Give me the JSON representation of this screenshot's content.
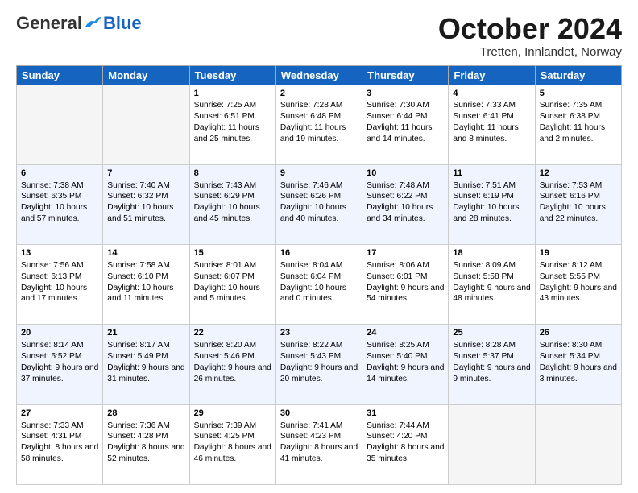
{
  "header": {
    "logo_general": "General",
    "logo_blue": "Blue",
    "title": "October 2024",
    "location": "Tretten, Innlandet, Norway"
  },
  "weekdays": [
    "Sunday",
    "Monday",
    "Tuesday",
    "Wednesday",
    "Thursday",
    "Friday",
    "Saturday"
  ],
  "weeks": [
    [
      {
        "day": "",
        "sunrise": "",
        "sunset": "",
        "daylight": "",
        "empty": true
      },
      {
        "day": "",
        "sunrise": "",
        "sunset": "",
        "daylight": "",
        "empty": true
      },
      {
        "day": "1",
        "sunrise": "Sunrise: 7:25 AM",
        "sunset": "Sunset: 6:51 PM",
        "daylight": "Daylight: 11 hours and 25 minutes."
      },
      {
        "day": "2",
        "sunrise": "Sunrise: 7:28 AM",
        "sunset": "Sunset: 6:48 PM",
        "daylight": "Daylight: 11 hours and 19 minutes."
      },
      {
        "day": "3",
        "sunrise": "Sunrise: 7:30 AM",
        "sunset": "Sunset: 6:44 PM",
        "daylight": "Daylight: 11 hours and 14 minutes."
      },
      {
        "day": "4",
        "sunrise": "Sunrise: 7:33 AM",
        "sunset": "Sunset: 6:41 PM",
        "daylight": "Daylight: 11 hours and 8 minutes."
      },
      {
        "day": "5",
        "sunrise": "Sunrise: 7:35 AM",
        "sunset": "Sunset: 6:38 PM",
        "daylight": "Daylight: 11 hours and 2 minutes."
      }
    ],
    [
      {
        "day": "6",
        "sunrise": "Sunrise: 7:38 AM",
        "sunset": "Sunset: 6:35 PM",
        "daylight": "Daylight: 10 hours and 57 minutes."
      },
      {
        "day": "7",
        "sunrise": "Sunrise: 7:40 AM",
        "sunset": "Sunset: 6:32 PM",
        "daylight": "Daylight: 10 hours and 51 minutes."
      },
      {
        "day": "8",
        "sunrise": "Sunrise: 7:43 AM",
        "sunset": "Sunset: 6:29 PM",
        "daylight": "Daylight: 10 hours and 45 minutes."
      },
      {
        "day": "9",
        "sunrise": "Sunrise: 7:46 AM",
        "sunset": "Sunset: 6:26 PM",
        "daylight": "Daylight: 10 hours and 40 minutes."
      },
      {
        "day": "10",
        "sunrise": "Sunrise: 7:48 AM",
        "sunset": "Sunset: 6:22 PM",
        "daylight": "Daylight: 10 hours and 34 minutes."
      },
      {
        "day": "11",
        "sunrise": "Sunrise: 7:51 AM",
        "sunset": "Sunset: 6:19 PM",
        "daylight": "Daylight: 10 hours and 28 minutes."
      },
      {
        "day": "12",
        "sunrise": "Sunrise: 7:53 AM",
        "sunset": "Sunset: 6:16 PM",
        "daylight": "Daylight: 10 hours and 22 minutes."
      }
    ],
    [
      {
        "day": "13",
        "sunrise": "Sunrise: 7:56 AM",
        "sunset": "Sunset: 6:13 PM",
        "daylight": "Daylight: 10 hours and 17 minutes."
      },
      {
        "day": "14",
        "sunrise": "Sunrise: 7:58 AM",
        "sunset": "Sunset: 6:10 PM",
        "daylight": "Daylight: 10 hours and 11 minutes."
      },
      {
        "day": "15",
        "sunrise": "Sunrise: 8:01 AM",
        "sunset": "Sunset: 6:07 PM",
        "daylight": "Daylight: 10 hours and 5 minutes."
      },
      {
        "day": "16",
        "sunrise": "Sunrise: 8:04 AM",
        "sunset": "Sunset: 6:04 PM",
        "daylight": "Daylight: 10 hours and 0 minutes."
      },
      {
        "day": "17",
        "sunrise": "Sunrise: 8:06 AM",
        "sunset": "Sunset: 6:01 PM",
        "daylight": "Daylight: 9 hours and 54 minutes."
      },
      {
        "day": "18",
        "sunrise": "Sunrise: 8:09 AM",
        "sunset": "Sunset: 5:58 PM",
        "daylight": "Daylight: 9 hours and 48 minutes."
      },
      {
        "day": "19",
        "sunrise": "Sunrise: 8:12 AM",
        "sunset": "Sunset: 5:55 PM",
        "daylight": "Daylight: 9 hours and 43 minutes."
      }
    ],
    [
      {
        "day": "20",
        "sunrise": "Sunrise: 8:14 AM",
        "sunset": "Sunset: 5:52 PM",
        "daylight": "Daylight: 9 hours and 37 minutes."
      },
      {
        "day": "21",
        "sunrise": "Sunrise: 8:17 AM",
        "sunset": "Sunset: 5:49 PM",
        "daylight": "Daylight: 9 hours and 31 minutes."
      },
      {
        "day": "22",
        "sunrise": "Sunrise: 8:20 AM",
        "sunset": "Sunset: 5:46 PM",
        "daylight": "Daylight: 9 hours and 26 minutes."
      },
      {
        "day": "23",
        "sunrise": "Sunrise: 8:22 AM",
        "sunset": "Sunset: 5:43 PM",
        "daylight": "Daylight: 9 hours and 20 minutes."
      },
      {
        "day": "24",
        "sunrise": "Sunrise: 8:25 AM",
        "sunset": "Sunset: 5:40 PM",
        "daylight": "Daylight: 9 hours and 14 minutes."
      },
      {
        "day": "25",
        "sunrise": "Sunrise: 8:28 AM",
        "sunset": "Sunset: 5:37 PM",
        "daylight": "Daylight: 9 hours and 9 minutes."
      },
      {
        "day": "26",
        "sunrise": "Sunrise: 8:30 AM",
        "sunset": "Sunset: 5:34 PM",
        "daylight": "Daylight: 9 hours and 3 minutes."
      }
    ],
    [
      {
        "day": "27",
        "sunrise": "Sunrise: 7:33 AM",
        "sunset": "Sunset: 4:31 PM",
        "daylight": "Daylight: 8 hours and 58 minutes."
      },
      {
        "day": "28",
        "sunrise": "Sunrise: 7:36 AM",
        "sunset": "Sunset: 4:28 PM",
        "daylight": "Daylight: 8 hours and 52 minutes."
      },
      {
        "day": "29",
        "sunrise": "Sunrise: 7:39 AM",
        "sunset": "Sunset: 4:25 PM",
        "daylight": "Daylight: 8 hours and 46 minutes."
      },
      {
        "day": "30",
        "sunrise": "Sunrise: 7:41 AM",
        "sunset": "Sunset: 4:23 PM",
        "daylight": "Daylight: 8 hours and 41 minutes."
      },
      {
        "day": "31",
        "sunrise": "Sunrise: 7:44 AM",
        "sunset": "Sunset: 4:20 PM",
        "daylight": "Daylight: 8 hours and 35 minutes."
      },
      {
        "day": "",
        "sunrise": "",
        "sunset": "",
        "daylight": "",
        "empty": true
      },
      {
        "day": "",
        "sunrise": "",
        "sunset": "",
        "daylight": "",
        "empty": true
      }
    ]
  ]
}
